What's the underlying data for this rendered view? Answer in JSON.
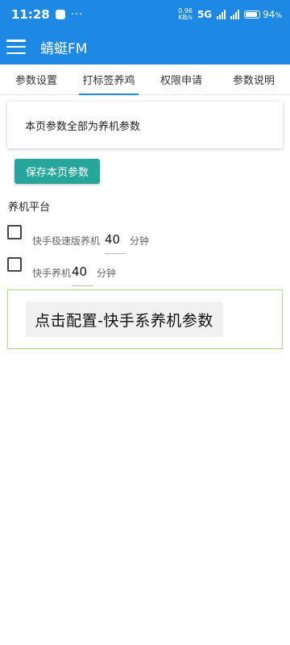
{
  "status_bar": {
    "time": "11:28",
    "more": "···",
    "net_speed_value": "0.96",
    "net_speed_unit": "KB/s",
    "network_type": "5G",
    "battery_percent": "94",
    "battery_suffix": "%",
    "battery_level": 0.94
  },
  "app_bar": {
    "title": "蜻蜓FM",
    "menu_icon": "hamburger-menu-icon"
  },
  "tabs": [
    {
      "label": "参数设置",
      "active": false
    },
    {
      "label": "打标签养鸡",
      "active": true
    },
    {
      "label": "权限申请",
      "active": false
    },
    {
      "label": "参数说明",
      "active": false
    }
  ],
  "info_card": {
    "text": "本页参数全部为养机参数"
  },
  "save_button": {
    "label": "保存本页参数"
  },
  "platform_section": {
    "label": "养机平台",
    "rows": [
      {
        "label": "快手极速版养机",
        "value": "40",
        "unit": "分钟",
        "checked": false
      },
      {
        "label": "快手养机",
        "value": "40",
        "unit": "分钟",
        "checked": false
      }
    ]
  },
  "config_button": {
    "label": "点击配置-快手系养机参数"
  },
  "colors": {
    "primary": "#1e88e5",
    "save_button": "#26a69a",
    "config_border": "#aed581"
  }
}
